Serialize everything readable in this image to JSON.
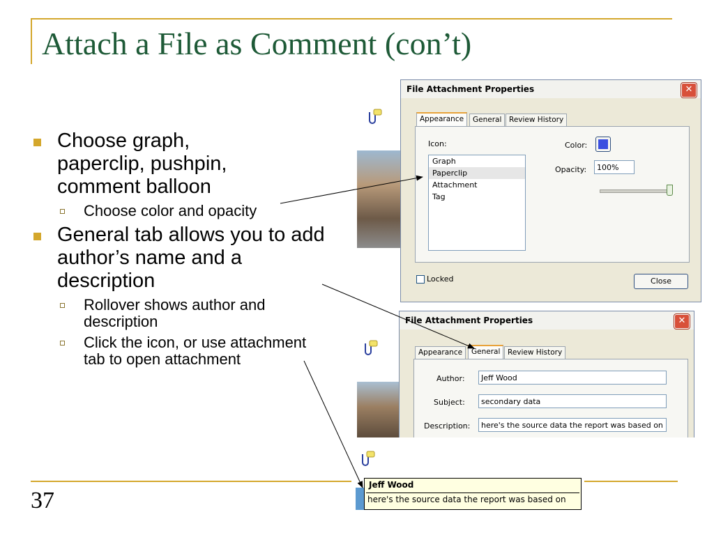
{
  "slide": {
    "title": "Attach a File as Comment (con’t)",
    "page_number": "37",
    "bullets": [
      {
        "text": "Choose graph, paperclip, pushpin, comment balloon",
        "sub": [
          "Choose color and opacity"
        ]
      },
      {
        "text": "General tab allows you to add author’s name and a description",
        "sub": [
          "Rollover shows author and description",
          "Click the icon, or use attachment tab to open attachment"
        ]
      }
    ]
  },
  "colors": {
    "accent": "#d4a72c",
    "title": "#1e5a37",
    "color_swatch": "#3a4fe0"
  },
  "dialog1": {
    "title": "File Attachment Properties",
    "tabs": [
      "Appearance",
      "General",
      "Review History"
    ],
    "icon_label": "Icon:",
    "icons": [
      "Graph",
      "Paperclip",
      "Attachment",
      "Tag"
    ],
    "selected_icon": "Paperclip",
    "color_label": "Color:",
    "opacity_label": "Opacity:",
    "opacity_value": "100%",
    "opacity_level": 1.0,
    "locked_label": "Locked",
    "close_label": "Close"
  },
  "dialog2": {
    "title": "File Attachment Properties",
    "tabs": [
      "Appearance",
      "General",
      "Review History"
    ],
    "author_label": "Author:",
    "author_value": "Jeff Wood",
    "subject_label": "Subject:",
    "subject_value": "secondary data",
    "description_label": "Description:",
    "description_value": "here's the source data the report was based on"
  },
  "tooltip": {
    "author": "Jeff Wood",
    "description": "here's the source data the report was based on"
  },
  "icons": [
    "paperclip-comment-icon",
    "close-icon"
  ]
}
